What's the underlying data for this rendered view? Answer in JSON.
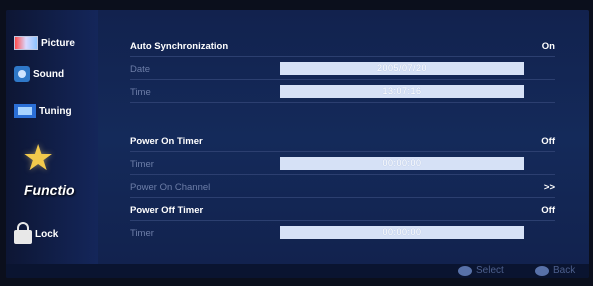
{
  "sidebar": {
    "items": [
      {
        "label": "Picture",
        "icon": "picture-icon"
      },
      {
        "label": "Sound",
        "icon": "sound-icon"
      },
      {
        "label": "Tuning",
        "icon": "tuning-icon"
      },
      {
        "label": "Functio",
        "icon": "star-icon",
        "active": true
      },
      {
        "label": "Lock",
        "icon": "lock-icon"
      }
    ]
  },
  "main": {
    "auto_sync": {
      "label": "Auto Synchronization",
      "value": "On"
    },
    "date": {
      "label": "Date",
      "value": "2005/07/20"
    },
    "time": {
      "label": "Time",
      "value": "13:07:16"
    },
    "power_on_timer": {
      "label": "Power On Timer",
      "value": "Off"
    },
    "on_timer": {
      "label": "Timer",
      "value": "00:00:00"
    },
    "power_on_channel": {
      "label": "Power On Channel",
      "value": ">>"
    },
    "power_off_timer": {
      "label": "Power Off Timer",
      "value": "Off"
    },
    "off_timer": {
      "label": "Timer",
      "value": "00:00:00"
    }
  },
  "footer": {
    "select_label": "Select",
    "back_label": "Back"
  }
}
